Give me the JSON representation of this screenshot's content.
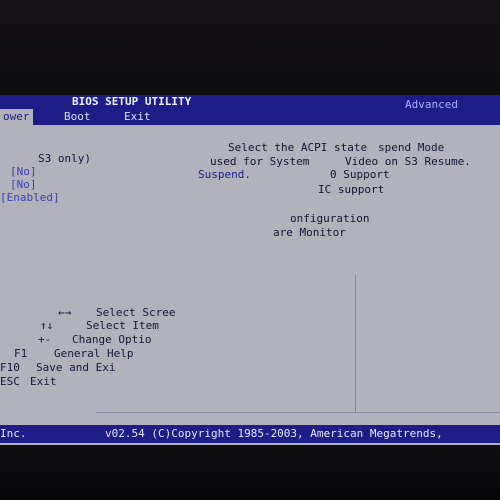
{
  "header": {
    "title": "BIOS SETUP UTILITY",
    "tab_right": "Advanced"
  },
  "menu": [
    {
      "label": "ower",
      "active": true
    },
    {
      "label": "Boot",
      "active": false
    },
    {
      "label": "Exit",
      "active": false
    }
  ],
  "left_panel": {
    "s3_only": "S3 only)",
    "opt1": "[No]",
    "opt2": "[No]",
    "opt3": "[Enabled]"
  },
  "help": {
    "line1": "Select the ACPI state",
    "line1b": "spend Mode",
    "line2": "used for System",
    "line2b": "Video on S3 Resume.",
    "line3": "Suspend.",
    "line3b": "0 Support",
    "line4": "IC support",
    "line5": "onfiguration",
    "line6": "are Monitor"
  },
  "keys": [
    {
      "key": "←→",
      "action": "Select Scree"
    },
    {
      "key": "↑↓",
      "action": "Select Item"
    },
    {
      "key": "+-",
      "action": "Change Optio"
    },
    {
      "key": "F1",
      "action": "General Help"
    },
    {
      "key": "F10",
      "action": "Save and Exi"
    },
    {
      "key": "ESC",
      "action": "Exit"
    }
  ],
  "footer": {
    "left": "Inc.",
    "copyright": "v02.54 (C)Copyright 1985-2003, American Megatrends,"
  },
  "colors": {
    "bar_blue": "#1c1d86",
    "screen_gray": "#b2b2bc",
    "highlight_blue": "#3b3fb0"
  }
}
